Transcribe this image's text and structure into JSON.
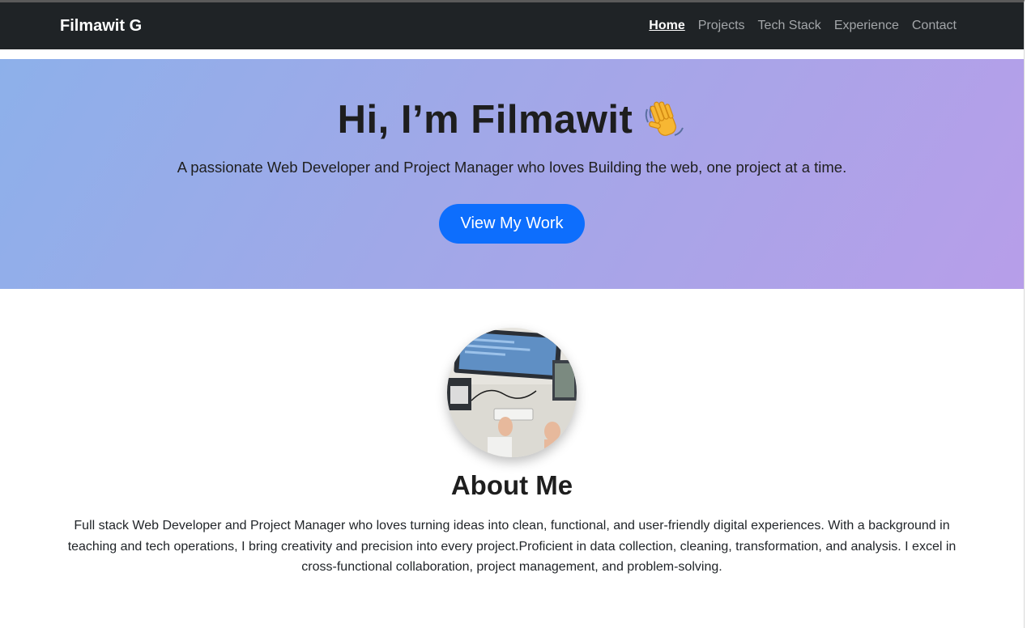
{
  "navbar": {
    "brand": "Filmawit G",
    "links": [
      {
        "label": "Home",
        "active": true
      },
      {
        "label": "Projects",
        "active": false
      },
      {
        "label": "Tech Stack",
        "active": false
      },
      {
        "label": "Experience",
        "active": false
      },
      {
        "label": "Contact",
        "active": false
      }
    ]
  },
  "hero": {
    "title": "Hi, I’m Filmawit",
    "title_icon": "waving-hand-icon",
    "subtitle": "A passionate Web Developer and Project Manager who loves Building the web, one project at a time.",
    "cta_label": "View My Work"
  },
  "about": {
    "avatar": "workspace-photo",
    "title": "About Me",
    "text": "Full stack Web Developer and Project Manager who loves turning ideas into clean, functional, and user-friendly digital experiences. With a background in teaching and tech operations, I bring creativity and precision into every project.Proficient in data collection, cleaning, transformation, and analysis. I excel in cross-functional collaboration, project management, and problem-solving."
  },
  "colors": {
    "navbar_bg": "#1f2326",
    "hero_gradient_start": "#8db0ea",
    "hero_gradient_end": "#b79ee9",
    "accent": "#0d6efd"
  }
}
